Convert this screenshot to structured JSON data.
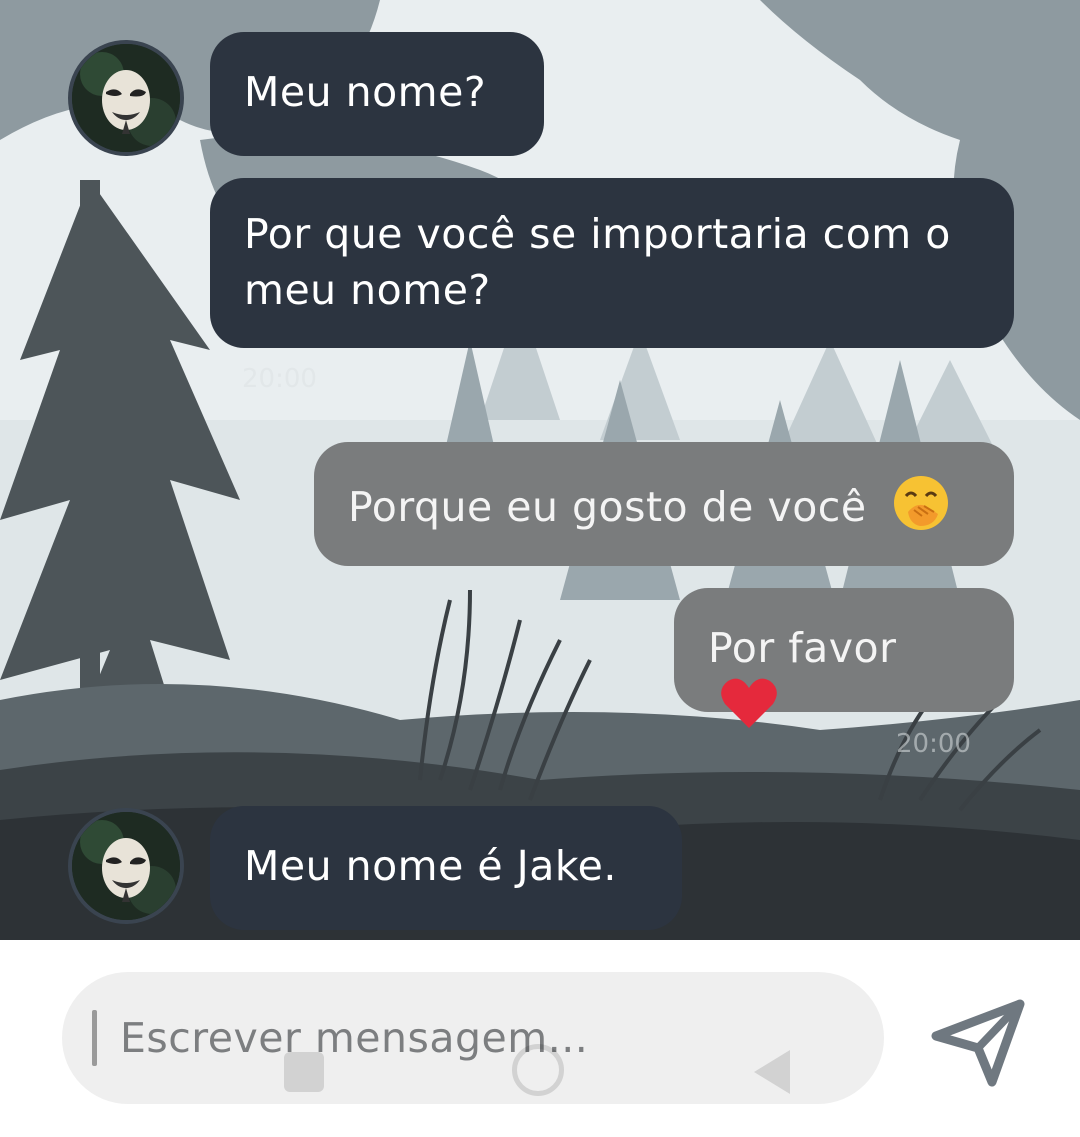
{
  "messages": [
    {
      "side": "in",
      "text": "Meu nome?"
    },
    {
      "side": "in",
      "text": "Por que você se importaria com o meu nome?"
    },
    {
      "side": "out",
      "text": "Porque eu gosto de você",
      "emoji": "face-with-hand-over-mouth-emoji"
    },
    {
      "side": "out",
      "text": "Por favor",
      "emoji": "red-heart-emoji"
    },
    {
      "side": "in",
      "text": "Meu nome é Jake."
    }
  ],
  "timestamps": {
    "incoming_group_1": "20:00",
    "outgoing_group_1": "20:00"
  },
  "composer": {
    "placeholder": "Escrever mensagem...",
    "send_icon": "send-icon"
  },
  "avatar": {
    "icon": "masked-user-avatar"
  },
  "colors": {
    "incoming_bubble": "#2c3440",
    "outgoing_bubble": "#7a7c7d",
    "composer_background": "#efefef",
    "send_icon": "#6f7880"
  }
}
